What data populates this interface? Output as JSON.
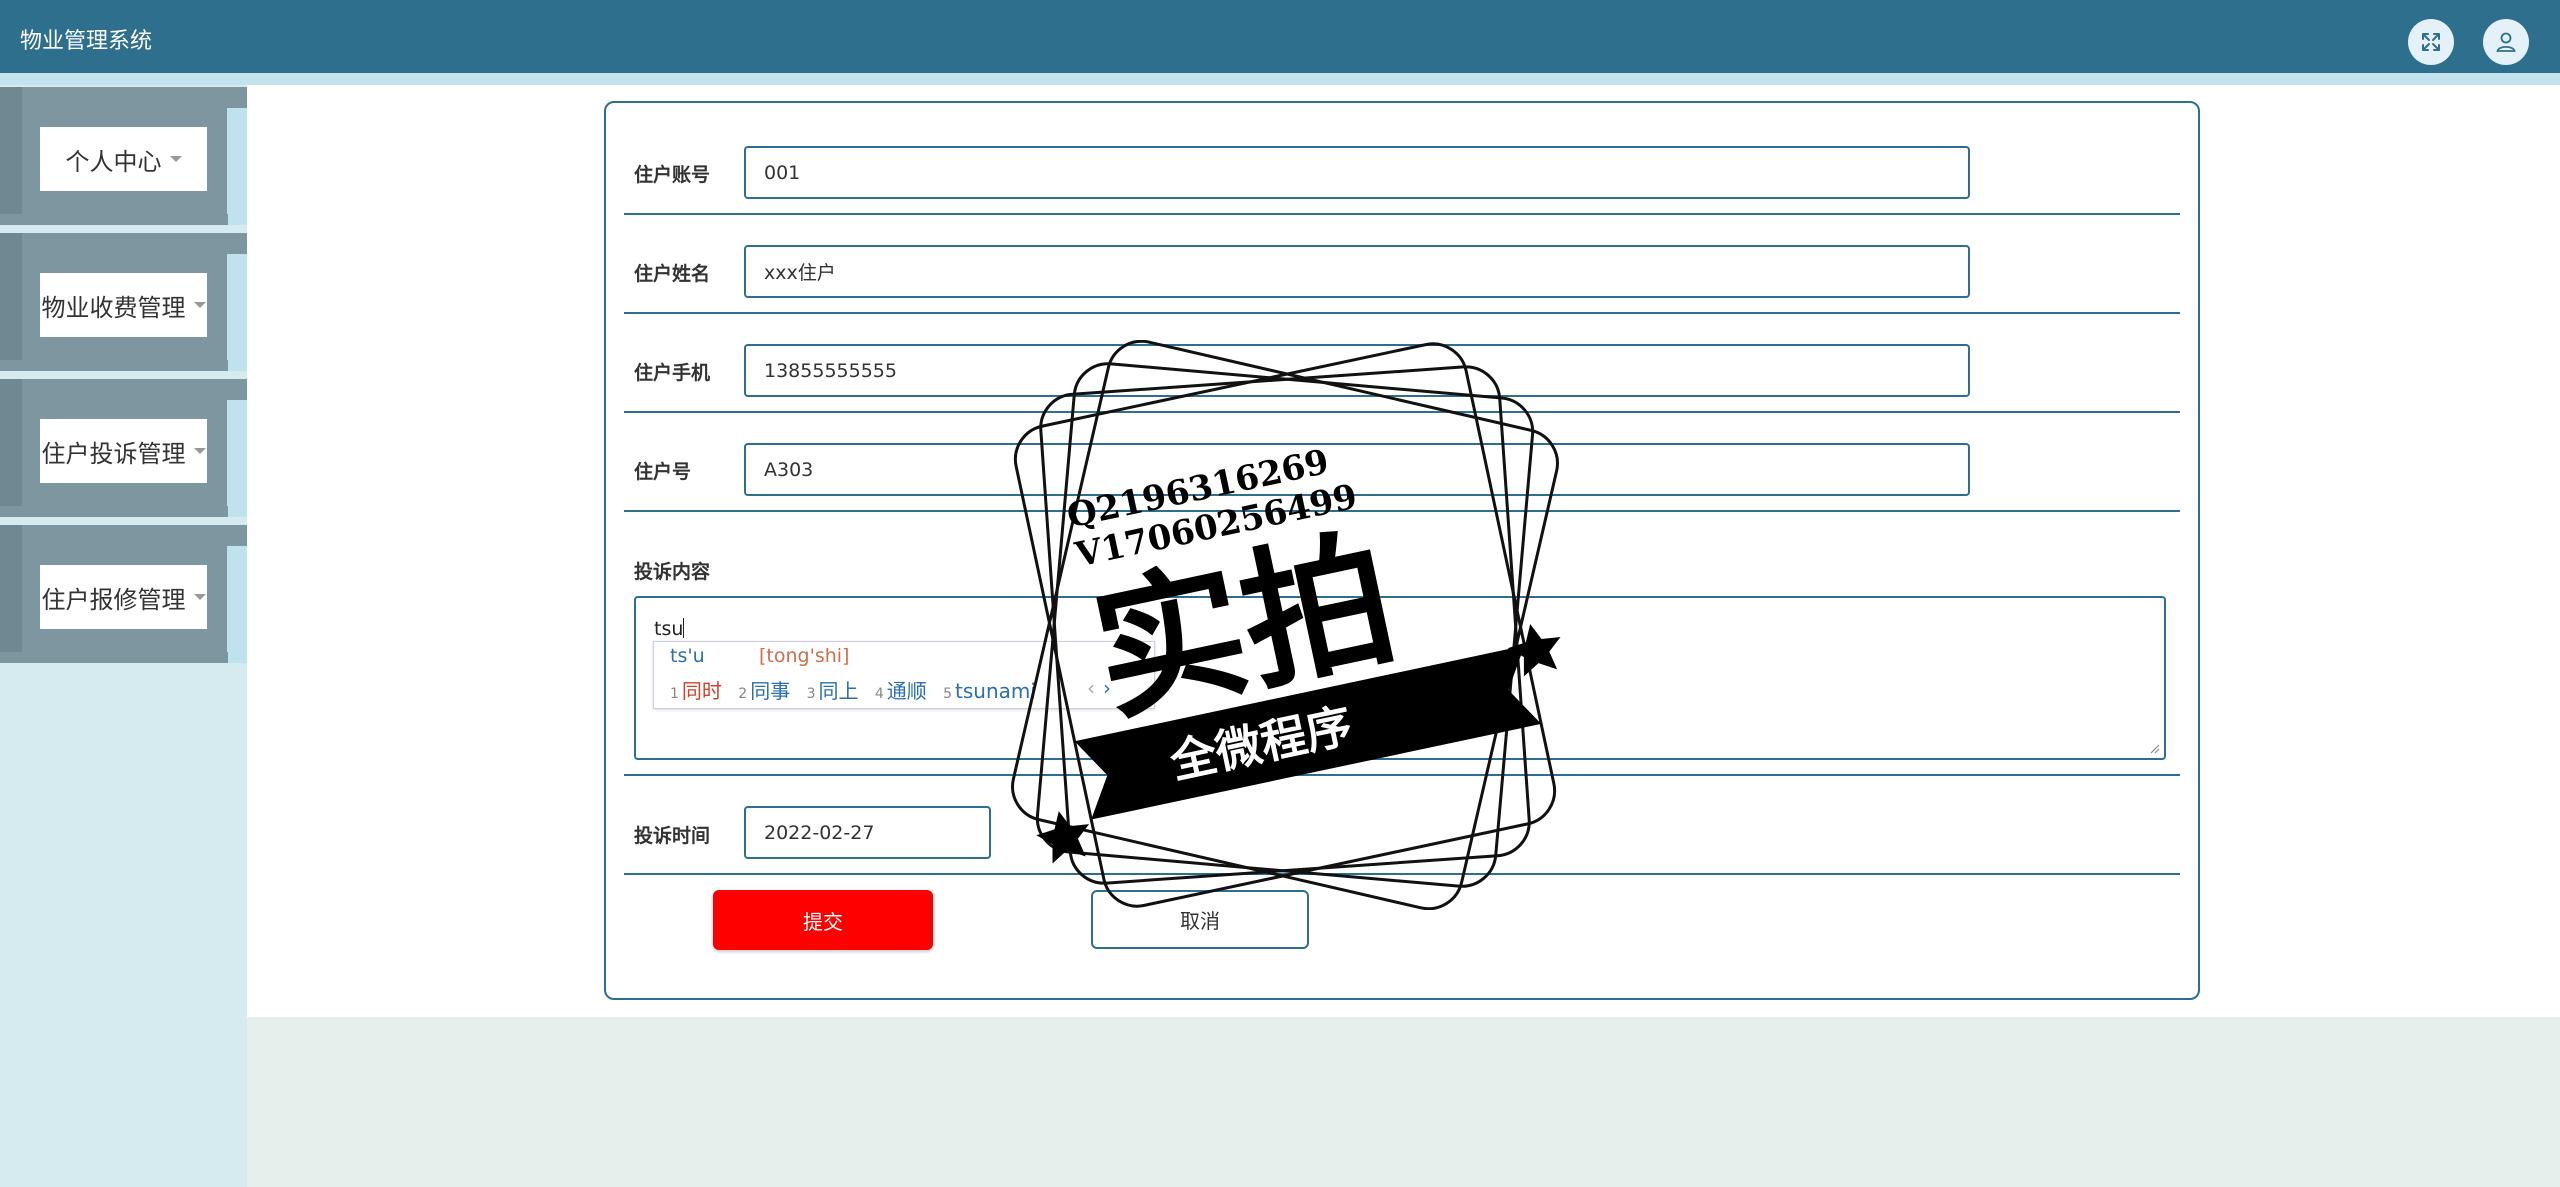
{
  "app": {
    "title": "物业管理系统"
  },
  "header": {
    "fullscreen_icon": "fullscreen-icon",
    "user_icon": "user-icon"
  },
  "sidebar": {
    "items": [
      {
        "label": "个人中心"
      },
      {
        "label": "物业收费管理"
      },
      {
        "label": "住户投诉管理"
      },
      {
        "label": "住户报修管理"
      }
    ]
  },
  "form": {
    "account": {
      "label": "住户账号",
      "value": "001"
    },
    "name": {
      "label": "住户姓名",
      "value": "xxx住户"
    },
    "phone": {
      "label": "住户手机",
      "value": "13855555555"
    },
    "unit": {
      "label": "住户号",
      "value": "A303"
    },
    "content": {
      "label": "投诉内容",
      "value": "tsu"
    },
    "time": {
      "label": "投诉时间",
      "value": "2022-02-27"
    },
    "submit_label": "提交",
    "cancel_label": "取消"
  },
  "ime": {
    "input": "ts'u",
    "pinyin": "[tong'shi]",
    "candidates": [
      {
        "num": "1",
        "text": "同时"
      },
      {
        "num": "2",
        "text": "同事"
      },
      {
        "num": "3",
        "text": "同上"
      },
      {
        "num": "4",
        "text": "通顺"
      },
      {
        "num": "5",
        "text": "tsunami"
      }
    ],
    "prev": "‹",
    "next": "›"
  },
  "watermark": {
    "line1": "Q2196316269",
    "line2": "V17060256499",
    "main": "实拍",
    "banner": "全微程序"
  }
}
